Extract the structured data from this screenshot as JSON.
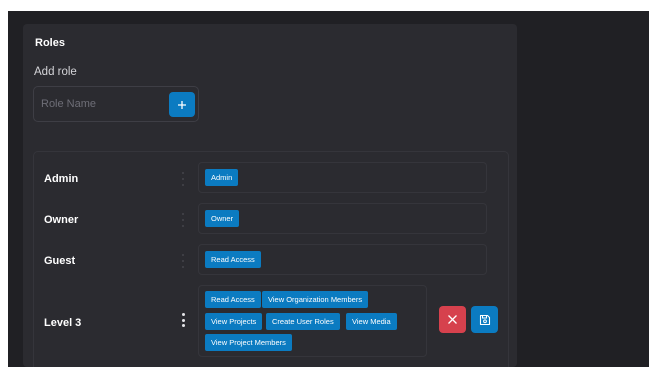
{
  "roles_panel": {
    "title": "Roles",
    "add_role": {
      "label": "Add role",
      "placeholder": "Role Name",
      "value": "",
      "add_icon": "plus-icon"
    },
    "roles": [
      {
        "name": "Admin",
        "permissions": [
          "Admin"
        ],
        "menu_icon": "kebab-menu-icon"
      },
      {
        "name": "Owner",
        "permissions": [
          "Owner"
        ],
        "menu_icon": "kebab-menu-icon"
      },
      {
        "name": "Guest",
        "permissions": [
          "Read Access"
        ],
        "menu_icon": "kebab-menu-icon"
      },
      {
        "name": "Level 3",
        "editing": true,
        "permissions": [
          "Read Access",
          "View Organization Members",
          "View Projects",
          "Create User Roles",
          "View Media",
          "View Project Members"
        ],
        "menu_icon": "kebab-menu-icon",
        "actions": {
          "delete_icon": "close-icon",
          "save_icon": "save-icon"
        }
      }
    ]
  },
  "colors": {
    "page_background": "#202024",
    "panel_background": "#2b2b30",
    "accent": "#0b7bc1",
    "danger": "#d6414d",
    "text": "#ffffff"
  }
}
